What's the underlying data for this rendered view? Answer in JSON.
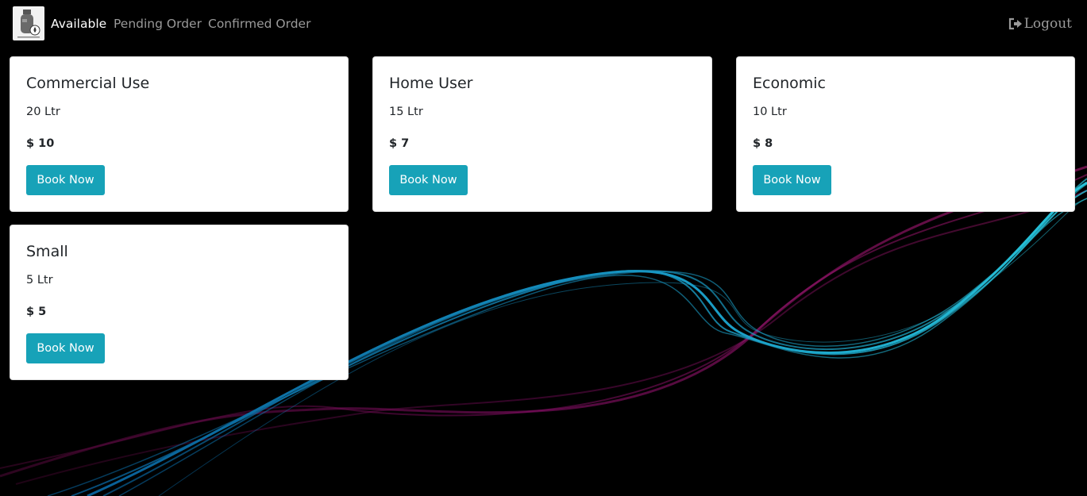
{
  "nav": {
    "items": [
      {
        "label": "Available",
        "active": true
      },
      {
        "label": "Pending Order",
        "active": false
      },
      {
        "label": "Confirmed Order",
        "active": false
      }
    ],
    "logout_label": "Logout",
    "logout_icon": "sign-out-icon",
    "logo_icon": "gas-cylinder-icon"
  },
  "products": [
    {
      "title": "Commercial Use",
      "volume": "20 Ltr",
      "price": "$ 10",
      "button_label": "Book Now"
    },
    {
      "title": "Home User",
      "volume": "15 Ltr",
      "price": "$ 7",
      "button_label": "Book Now"
    },
    {
      "title": "Economic",
      "volume": "10 Ltr",
      "price": "$ 8",
      "button_label": "Book Now"
    },
    {
      "title": "Small",
      "volume": "5 Ltr",
      "price": "$ 5",
      "button_label": "Book Now"
    }
  ],
  "colors": {
    "background": "#000000",
    "accent_button": "#17a2b8",
    "nav_active": "#ffffff",
    "nav_inactive": "#9a9a9a",
    "wave_cyan": "#1fd6ff",
    "wave_magenta": "#c0208a"
  }
}
